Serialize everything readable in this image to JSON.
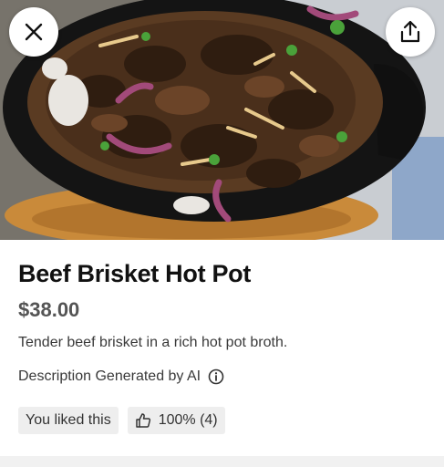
{
  "header": {
    "close_icon": "close-icon",
    "share_icon": "share-icon"
  },
  "item": {
    "name": "Beef Brisket Hot Pot",
    "price": "$38.00",
    "description": "Tender beef brisket in a rich hot pot broth.",
    "ai_note": "Description Generated by AI",
    "info_icon": "info-icon"
  },
  "chips": {
    "liked_label": "You liked this",
    "rating_label": "100% (4)",
    "rating_icon": "thumbs-up-icon"
  },
  "colors": {
    "chip_bg": "#eeeeee",
    "price": "#545454",
    "divider": "#f1f1f1"
  }
}
